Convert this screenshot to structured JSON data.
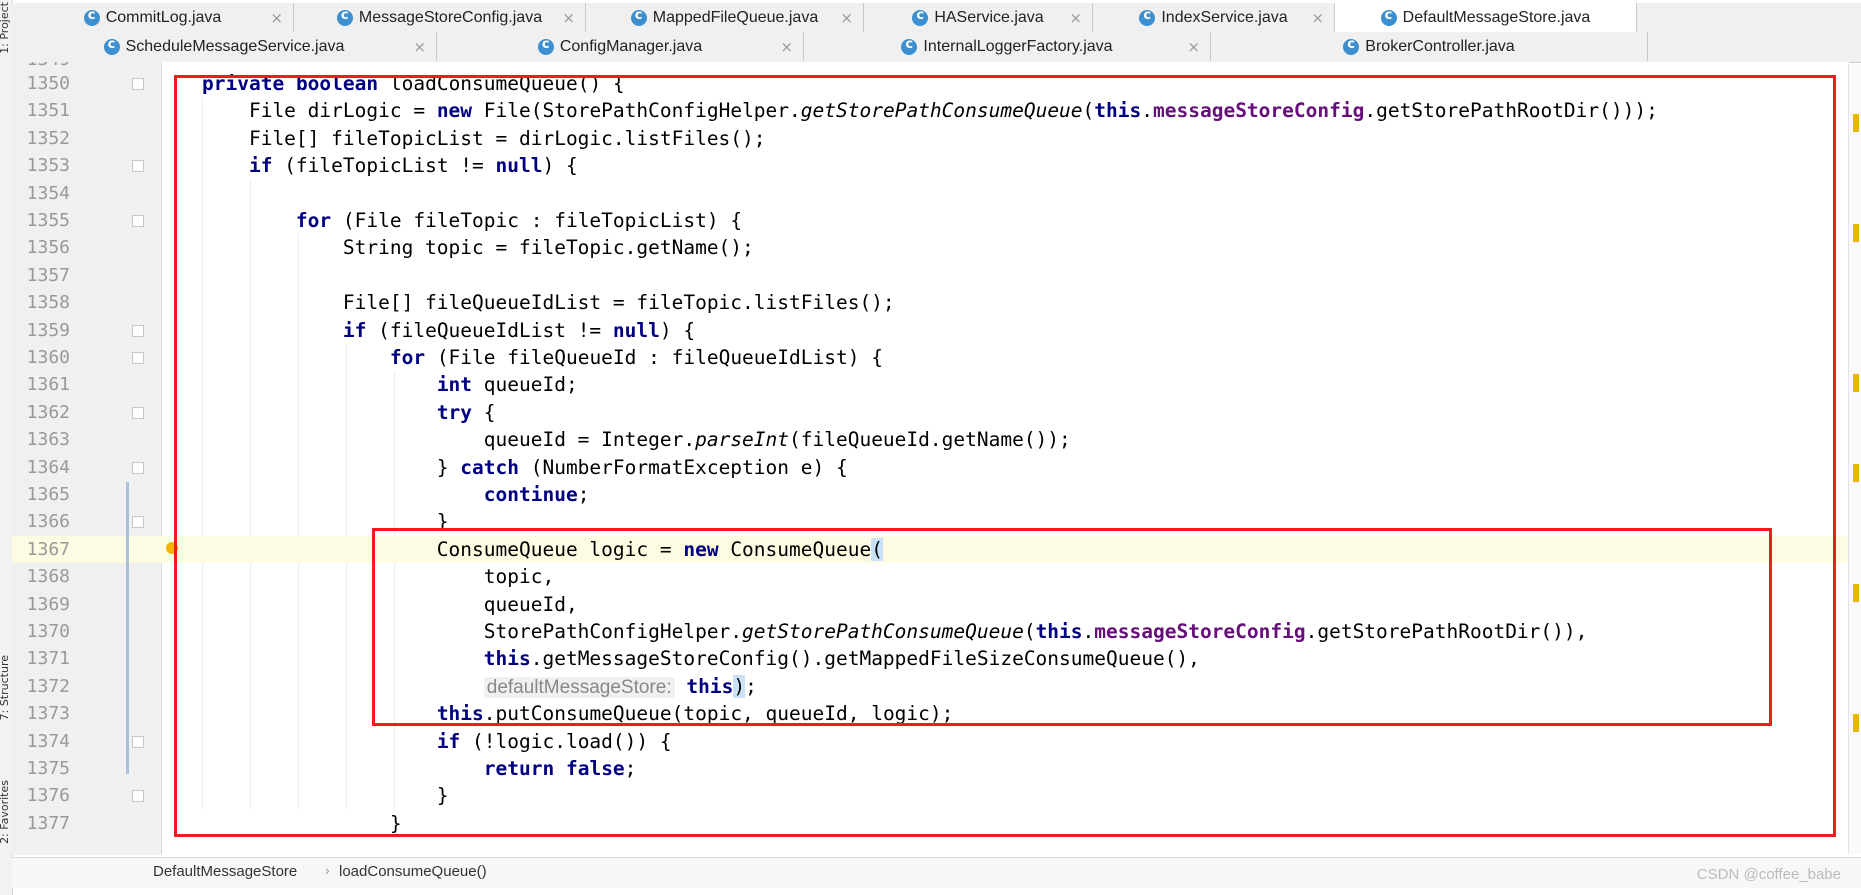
{
  "tool_strip": {
    "project": "1: Project",
    "structure": "7: Structure",
    "favorites": "2: Favorites"
  },
  "tabs_row1": [
    {
      "label": "CommitLog.java",
      "closable": true
    },
    {
      "label": "MessageStoreConfig.java",
      "closable": true
    },
    {
      "label": "MappedFileQueue.java",
      "closable": true
    },
    {
      "label": "HAService.java",
      "closable": true
    },
    {
      "label": "IndexService.java",
      "closable": true
    },
    {
      "label": "DefaultMessageStore.java",
      "closable": false,
      "active": true
    }
  ],
  "tabs_row2": [
    {
      "label": "ScheduleMessageService.java",
      "closable": true
    },
    {
      "label": "ConfigManager.java",
      "closable": true
    },
    {
      "label": "InternalLoggerFactory.java",
      "closable": true
    },
    {
      "label": "BrokerController.java",
      "closable": false
    }
  ],
  "editor": {
    "first_partial_line": "1349",
    "current_line": "1367",
    "lines": [
      {
        "num": "1350",
        "fold": true,
        "code": [
          {
            "t": "private",
            "c": "kw"
          },
          {
            "t": " "
          },
          {
            "t": "boolean",
            "c": "kw"
          },
          {
            "t": " loadConsumeQueue() {"
          }
        ]
      },
      {
        "num": "1351",
        "code": [
          {
            "t": "    File dirLogic = "
          },
          {
            "t": "new",
            "c": "kw"
          },
          {
            "t": " File(StorePathConfigHelper."
          },
          {
            "t": "getStorePathConsumeQueue",
            "c": "it"
          },
          {
            "t": "("
          },
          {
            "t": "this",
            "c": "kw"
          },
          {
            "t": "."
          },
          {
            "t": "messageStoreConfig",
            "c": "fld"
          },
          {
            "t": ".getStorePathRootDir()));"
          }
        ]
      },
      {
        "num": "1352",
        "code": [
          {
            "t": "    File[] fileTopicList = dirLogic.listFiles();"
          }
        ]
      },
      {
        "num": "1353",
        "fold": true,
        "code": [
          {
            "t": "    "
          },
          {
            "t": "if",
            "c": "kw"
          },
          {
            "t": " (fileTopicList != "
          },
          {
            "t": "null",
            "c": "kw"
          },
          {
            "t": ") {"
          }
        ]
      },
      {
        "num": "1354",
        "code": []
      },
      {
        "num": "1355",
        "fold": true,
        "code": [
          {
            "t": "        "
          },
          {
            "t": "for",
            "c": "kw"
          },
          {
            "t": " (File fileTopic : fileTopicList) {"
          }
        ]
      },
      {
        "num": "1356",
        "code": [
          {
            "t": "            String topic = fileTopic.getName();"
          }
        ]
      },
      {
        "num": "1357",
        "code": []
      },
      {
        "num": "1358",
        "code": [
          {
            "t": "            File[] fileQueueIdList = fileTopic.listFiles();"
          }
        ]
      },
      {
        "num": "1359",
        "fold": true,
        "code": [
          {
            "t": "            "
          },
          {
            "t": "if",
            "c": "kw"
          },
          {
            "t": " (fileQueueIdList != "
          },
          {
            "t": "null",
            "c": "kw"
          },
          {
            "t": ") {"
          }
        ]
      },
      {
        "num": "1360",
        "fold": true,
        "code": [
          {
            "t": "                "
          },
          {
            "t": "for",
            "c": "kw"
          },
          {
            "t": " (File fileQueueId : fileQueueIdList) {"
          }
        ]
      },
      {
        "num": "1361",
        "code": [
          {
            "t": "                    "
          },
          {
            "t": "int",
            "c": "kw"
          },
          {
            "t": " queueId;"
          }
        ]
      },
      {
        "num": "1362",
        "fold": true,
        "code": [
          {
            "t": "                    "
          },
          {
            "t": "try",
            "c": "kw"
          },
          {
            "t": " {"
          }
        ]
      },
      {
        "num": "1363",
        "code": [
          {
            "t": "                        queueId = Integer."
          },
          {
            "t": "parseInt",
            "c": "it"
          },
          {
            "t": "(fileQueueId.getName());"
          }
        ]
      },
      {
        "num": "1364",
        "fold": true,
        "code": [
          {
            "t": "                    } "
          },
          {
            "t": "catch",
            "c": "kw"
          },
          {
            "t": " (NumberFormatException e) {"
          }
        ]
      },
      {
        "num": "1365",
        "code": [
          {
            "t": "                        "
          },
          {
            "t": "continue",
            "c": "kw"
          },
          {
            "t": ";"
          }
        ]
      },
      {
        "num": "1366",
        "fold": true,
        "code": [
          {
            "t": "                    }"
          }
        ]
      },
      {
        "num": "1367",
        "current": true,
        "bulb": true,
        "code": [
          {
            "t": "                    ConsumeQueue logic = "
          },
          {
            "t": "new",
            "c": "kw"
          },
          {
            "t": " ConsumeQueue"
          },
          {
            "t": "(",
            "c": "paren"
          }
        ]
      },
      {
        "num": "1368",
        "code": [
          {
            "t": "                        topic,"
          }
        ]
      },
      {
        "num": "1369",
        "code": [
          {
            "t": "                        queueId,"
          }
        ]
      },
      {
        "num": "1370",
        "code": [
          {
            "t": "                        StorePathConfigHelper."
          },
          {
            "t": "getStorePathConsumeQueue",
            "c": "it"
          },
          {
            "t": "("
          },
          {
            "t": "this",
            "c": "kw"
          },
          {
            "t": "."
          },
          {
            "t": "messageStoreConfig",
            "c": "fld"
          },
          {
            "t": ".getStorePathRootDir()),"
          }
        ]
      },
      {
        "num": "1371",
        "code": [
          {
            "t": "                        "
          },
          {
            "t": "this",
            "c": "kw"
          },
          {
            "t": ".getMessageStoreConfig().getMappedFileSizeConsumeQueue(),"
          }
        ]
      },
      {
        "num": "1372",
        "code": [
          {
            "t": "                        "
          },
          {
            "t": "defaultMessageStore:",
            "c": "hint"
          },
          {
            "t": " "
          },
          {
            "t": "this",
            "c": "kw"
          },
          {
            "t": ")",
            "c": "paren"
          },
          {
            "t": ";"
          }
        ]
      },
      {
        "num": "1373",
        "code": [
          {
            "t": "                    "
          },
          {
            "t": "this",
            "c": "kw"
          },
          {
            "t": ".putConsumeQueue(topic, queueId, logic);"
          }
        ]
      },
      {
        "num": "1374",
        "fold": true,
        "code": [
          {
            "t": "                    "
          },
          {
            "t": "if",
            "c": "kw"
          },
          {
            "t": " (!logic.load()) {"
          }
        ]
      },
      {
        "num": "1375",
        "code": [
          {
            "t": "                        "
          },
          {
            "t": "return",
            "c": "kw"
          },
          {
            "t": " "
          },
          {
            "t": "false",
            "c": "kw"
          },
          {
            "t": ";"
          }
        ]
      },
      {
        "num": "1376",
        "fold": true,
        "code": [
          {
            "t": "                    }"
          }
        ]
      },
      {
        "num": "1377",
        "code": [
          {
            "t": "                }"
          }
        ]
      }
    ]
  },
  "breadcrumb": {
    "class_name": "DefaultMessageStore",
    "method_name": "loadConsumeQueue()"
  },
  "watermark": "CSDN @coffee_babe",
  "colors": {
    "keyword": "#000080",
    "field": "#660e7a",
    "highlight_box": "#ee1c1c",
    "current_line": "#fdfbe2"
  }
}
